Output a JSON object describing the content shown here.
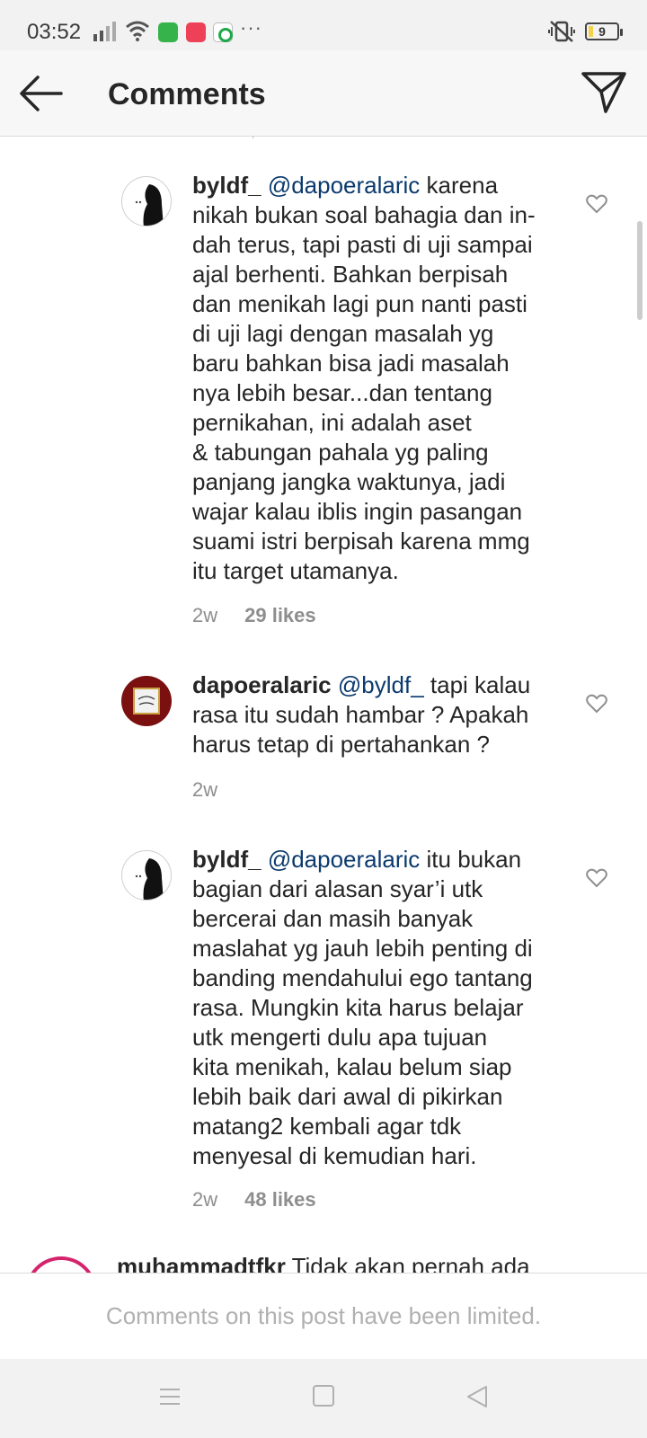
{
  "status_bar": {
    "time": "03:52",
    "battery_level": "9",
    "overflow": "···",
    "icons": [
      "signal-icon",
      "wifi-icon",
      "whatsapp-icon",
      "app-notification-icon",
      "app-notification-icon",
      "mute-vibrate-icon",
      "battery-icon"
    ]
  },
  "header": {
    "title": "Comments",
    "back_icon": "arrow-left-icon",
    "share_icon": "paper-plane-icon"
  },
  "comments": [
    {
      "username": "byldf_",
      "mention": "@dapoeralaric",
      "text_lines": [
        "karena",
        "nikah bukan soal bahagia dan in-",
        "dah terus, tapi pasti di uji sampai",
        "ajal berhenti. Bahkan berpisah",
        "dan menikah lagi pun nanti pasti",
        "di uji lagi dengan masalah yg",
        "baru bahkan bisa jadi masalah",
        "nya lebih besar...dan tentang",
        "pernikahan, ini adalah aset",
        "& tabungan pahala yg paling",
        "panjang jangka waktunya, jadi",
        "wajar kalau iblis ingin pasangan",
        "suami istri berpisah karena mmg",
        "itu target utamanya."
      ],
      "time": "2w",
      "likes": "29 likes"
    },
    {
      "username": "dapoeralaric",
      "mention": "@byldf_",
      "text_lines": [
        "tapi kalau",
        "rasa itu sudah hambar ? Apakah",
        "harus tetap di pertahankan ?"
      ],
      "time": "2w",
      "likes": ""
    },
    {
      "username": "byldf_",
      "mention": "@dapoeralaric",
      "text_lines": [
        "itu bukan",
        "bagian dari alasan syar’i utk",
        "bercerai dan masih banyak",
        "maslahat yg jauh lebih penting di",
        "banding mendahului ego tantang",
        "rasa. Mungkin kita harus belajar",
        "utk mengerti dulu apa tujuan",
        "kita menikah, kalau belum siap",
        "lebih baik dari awal di pikirkan",
        "matang2 kembali agar tdk",
        "menyesal di kemudian hari."
      ],
      "time": "2w",
      "likes": "48 likes"
    }
  ],
  "partial_comment": {
    "username": "muhammadtfkr",
    "text": "Tidak akan pernah ada"
  },
  "footer": {
    "limited_text": "Comments on this post have been limited."
  },
  "colors": {
    "mention": "#0b3a6e",
    "meta_gray": "#8e8e8e",
    "limited_gray": "#b0b0b0",
    "story_ring": "#d4246e"
  }
}
